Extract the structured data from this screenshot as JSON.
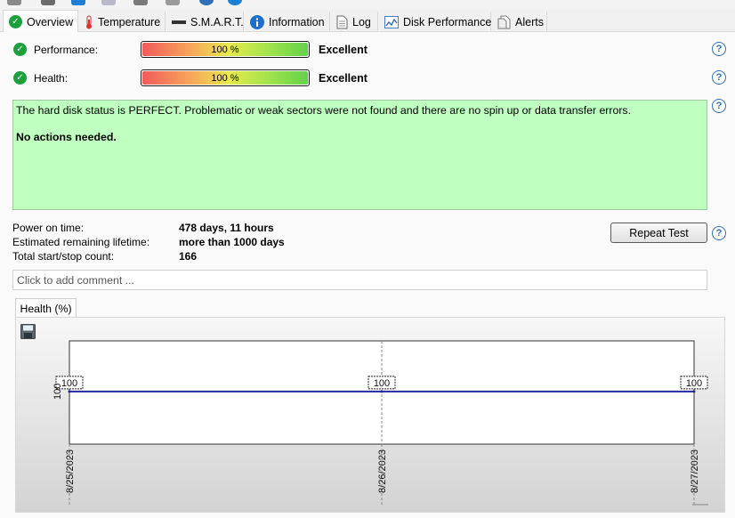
{
  "tabs": [
    {
      "label": "Overview",
      "icon": "check-circle-icon",
      "active": true
    },
    {
      "label": "Temperature",
      "icon": "thermometer-icon"
    },
    {
      "label": "S.M.A.R.T.",
      "icon": "drive-icon"
    },
    {
      "label": "Information",
      "icon": "info-icon"
    },
    {
      "label": "Log",
      "icon": "document-icon"
    },
    {
      "label": "Disk Performance",
      "icon": "performance-chart-icon"
    },
    {
      "label": "Alerts",
      "icon": "alerts-icon"
    }
  ],
  "performance": {
    "label": "Performance:",
    "bar_text": "100 %",
    "value_pct": 100,
    "rating": "Excellent"
  },
  "health": {
    "label": "Health:",
    "bar_text": "100 %",
    "value_pct": 100,
    "rating": "Excellent"
  },
  "status": {
    "message": "The hard disk status is PERFECT. Problematic or weak sectors were not found and there are no spin up or data transfer errors.",
    "action": "No actions needed.",
    "background": "#bfffbf"
  },
  "info": {
    "power_on_label": "Power on time:",
    "power_on_value": "478 days, 11 hours",
    "lifetime_label": "Estimated remaining lifetime:",
    "lifetime_value": "more than 1000 days",
    "startstop_label": "Total start/stop count:",
    "startstop_value": "166"
  },
  "repeat_test_label": "Repeat Test",
  "help_symbol": "?",
  "comment_placeholder": "Click to add comment ...",
  "chart_tab_label": "Health (%)",
  "chart_data": {
    "type": "line",
    "title": "Health (%)",
    "x": [
      "8/25/2023",
      "8/26/2023",
      "8/27/2023"
    ],
    "series": [
      {
        "values": [
          100,
          100,
          100
        ],
        "color": "#1f2a9e"
      }
    ],
    "y_tick": "100",
    "grid": "vertical dashed"
  }
}
